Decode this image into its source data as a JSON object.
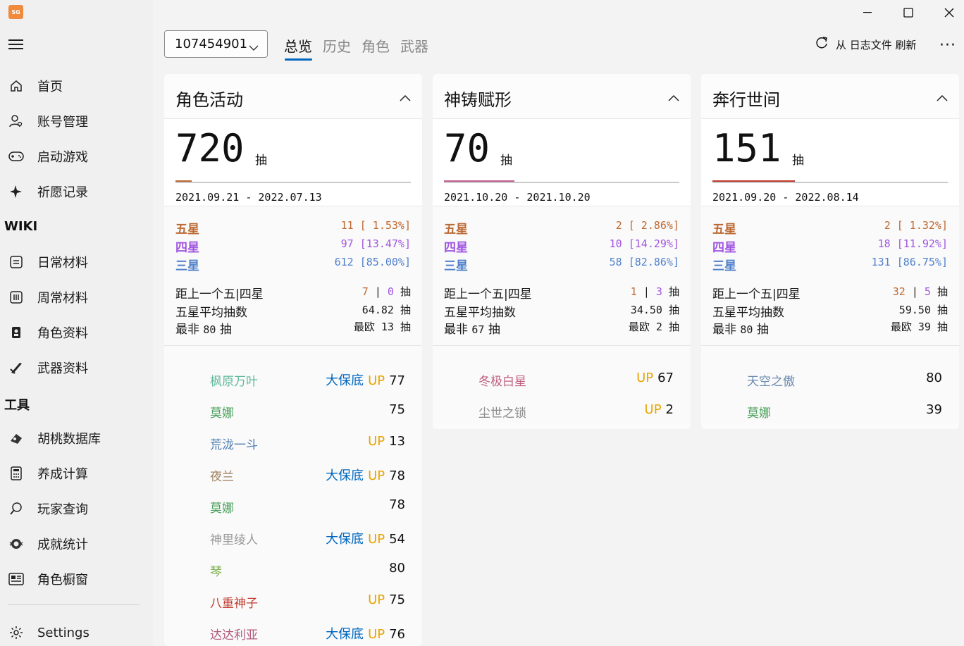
{
  "app": {
    "logo_text": "SG"
  },
  "sidebar": {
    "items": [
      {
        "label": "首页",
        "icon": "home-icon"
      },
      {
        "label": "账号管理",
        "icon": "account-icon"
      },
      {
        "label": "启动游戏",
        "icon": "gamepad-icon"
      },
      {
        "label": "祈愿记录",
        "icon": "sparkle-icon"
      }
    ],
    "section_wiki": "WIKI",
    "wiki_items": [
      {
        "label": "日常材料",
        "icon": "calendar-icon"
      },
      {
        "label": "周常材料",
        "icon": "calendar-week-icon"
      },
      {
        "label": "角色资料",
        "icon": "character-icon"
      },
      {
        "label": "武器资料",
        "icon": "weapon-icon"
      }
    ],
    "section_tools": "工具",
    "tool_items": [
      {
        "label": "胡桃数据库",
        "icon": "database-icon"
      },
      {
        "label": "养成计算",
        "icon": "calculator-icon"
      },
      {
        "label": "玩家查询",
        "icon": "search-icon"
      },
      {
        "label": "成就统计",
        "icon": "achievement-icon"
      },
      {
        "label": "角色橱窗",
        "icon": "showcase-icon"
      }
    ],
    "settings_label": "Settings"
  },
  "toolbar": {
    "uid": "107454901",
    "tabs": [
      "总览",
      "历史",
      "角色",
      "武器"
    ],
    "refresh_label": "从 日志文件 刷新",
    "more": "···"
  },
  "unit": "抽",
  "cards": [
    {
      "title": "角色活动",
      "total": "720",
      "progress": 0.07,
      "bar_color": "#bc6932",
      "range": "2021.09.21 - 2022.07.13",
      "five": {
        "label": "五星",
        "count": "11",
        "pct": "[ 1.53%]"
      },
      "four": {
        "label": "四星",
        "count": "97",
        "pct": "[13.47%]"
      },
      "three": {
        "label": "三星",
        "count": "612",
        "pct": "[85.00%]"
      },
      "since_label": "距上一个五|四星",
      "since5": "7",
      "since4": "0",
      "avg_label": "五星平均抽数",
      "avg": "64.82",
      "worst_label": "最非",
      "worst": "80",
      "best_label": "最欧",
      "best": "13",
      "items": [
        {
          "name": "枫原万叶",
          "color": "#5fb89a",
          "bao": "大保底",
          "up": "UP",
          "count": "77"
        },
        {
          "name": "莫娜",
          "color": "#4aa05a",
          "bao": "",
          "up": "",
          "count": "75"
        },
        {
          "name": "荒泷一斗",
          "color": "#4a7bb0",
          "bao": "",
          "up": "UP",
          "count": "13"
        },
        {
          "name": "夜兰",
          "color": "#a08060",
          "bao": "大保底",
          "up": "UP",
          "count": "78"
        },
        {
          "name": "莫娜",
          "color": "#4aa05a",
          "bao": "",
          "up": "",
          "count": "78"
        },
        {
          "name": "神里绫人",
          "color": "#9a9a9a",
          "bao": "大保底",
          "up": "UP",
          "count": "54"
        },
        {
          "name": "琴",
          "color": "#7ab04a",
          "bao": "",
          "up": "",
          "count": "80"
        },
        {
          "name": "八重神子",
          "color": "#c0392b",
          "bao": "",
          "up": "UP",
          "count": "75"
        },
        {
          "name": "达达利亚",
          "color": "#b05a7a",
          "bao": "大保底",
          "up": "UP",
          "count": "76"
        }
      ]
    },
    {
      "title": "神铸赋形",
      "total": "70",
      "progress": 0.3,
      "bar_color": "#c06090",
      "range": "2021.10.20 - 2021.10.20",
      "five": {
        "label": "五星",
        "count": "2",
        "pct": "[ 2.86%]"
      },
      "four": {
        "label": "四星",
        "count": "10",
        "pct": "[14.29%]"
      },
      "three": {
        "label": "三星",
        "count": "58",
        "pct": "[82.86%]"
      },
      "since_label": "距上一个五|四星",
      "since5": "1",
      "since4": "3",
      "avg_label": "五星平均抽数",
      "avg": "34.50",
      "worst_label": "最非",
      "worst": "67",
      "best_label": "最欧",
      "best": "2",
      "items": [
        {
          "name": "冬极白星",
          "color": "#c06080",
          "bao": "",
          "up": "UP",
          "count": "67"
        },
        {
          "name": "尘世之锁",
          "color": "#8a8a8a",
          "bao": "",
          "up": "UP",
          "count": "2"
        }
      ]
    },
    {
      "title": "奔行世间",
      "total": "151",
      "progress": 0.35,
      "bar_color": "#c0392b",
      "range": "2021.09.20 - 2022.08.14",
      "five": {
        "label": "五星",
        "count": "2",
        "pct": "[ 1.32%]"
      },
      "four": {
        "label": "四星",
        "count": "18",
        "pct": "[11.92%]"
      },
      "three": {
        "label": "三星",
        "count": "131",
        "pct": "[86.75%]"
      },
      "since_label": "距上一个五|四星",
      "since5": "32",
      "since4": "5",
      "avg_label": "五星平均抽数",
      "avg": "59.50",
      "worst_label": "最非",
      "worst": "80",
      "best_label": "最欧",
      "best": "39",
      "items": [
        {
          "name": "天空之傲",
          "color": "#6a8ab0",
          "bao": "",
          "up": "",
          "count": "80"
        },
        {
          "name": "莫娜",
          "color": "#4aa05a",
          "bao": "",
          "up": "",
          "count": "39"
        }
      ]
    }
  ]
}
